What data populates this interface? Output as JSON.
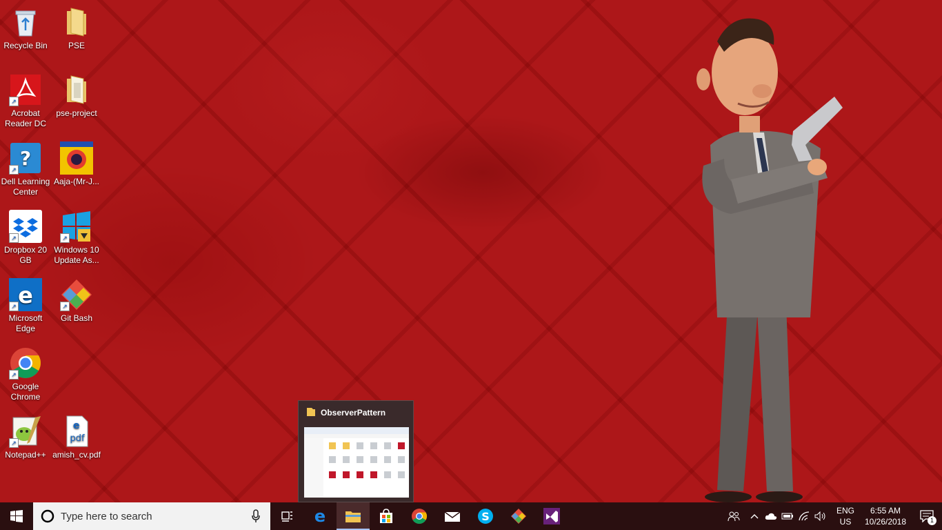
{
  "desktop": {
    "icons": [
      {
        "label": "Recycle Bin",
        "icon": "recycle-bin-icon"
      },
      {
        "label": "PSE",
        "icon": "folder-icon"
      },
      {
        "label": "Acrobat Reader DC",
        "icon": "acrobat-icon"
      },
      {
        "label": "pse-project",
        "icon": "folder-icon"
      },
      {
        "label": "Dell Learning Center",
        "icon": "help-icon"
      },
      {
        "label": "Aaja-(Mr-J...",
        "icon": "music-album-icon"
      },
      {
        "label": "Dropbox 20 GB",
        "icon": "dropbox-icon"
      },
      {
        "label": "Windows 10 Update As...",
        "icon": "windows-update-icon"
      },
      {
        "label": "Microsoft Edge",
        "icon": "edge-icon"
      },
      {
        "label": "Git Bash",
        "icon": "git-bash-icon"
      },
      {
        "label": "Google Chrome",
        "icon": "chrome-icon"
      },
      {
        "label": "Notepad++",
        "icon": "notepadpp-icon"
      },
      {
        "label": "amish_cv.pdf",
        "icon": "pdf-file-icon"
      }
    ]
  },
  "thumbnail": {
    "title": "ObserverPattern"
  },
  "taskbar": {
    "search_placeholder": "Type here to search",
    "pinned": [
      "start-icon",
      "cortana-icon",
      "task-view-icon",
      "edge-icon",
      "file-explorer-icon",
      "store-icon",
      "chrome-icon",
      "mail-icon",
      "skype-icon",
      "git-icon",
      "visual-studio-icon"
    ],
    "active_app": "file-explorer"
  },
  "tray": {
    "language": "ENG",
    "region": "US",
    "time": "6:55 AM",
    "date": "10/26/2018",
    "notifications": "1"
  }
}
